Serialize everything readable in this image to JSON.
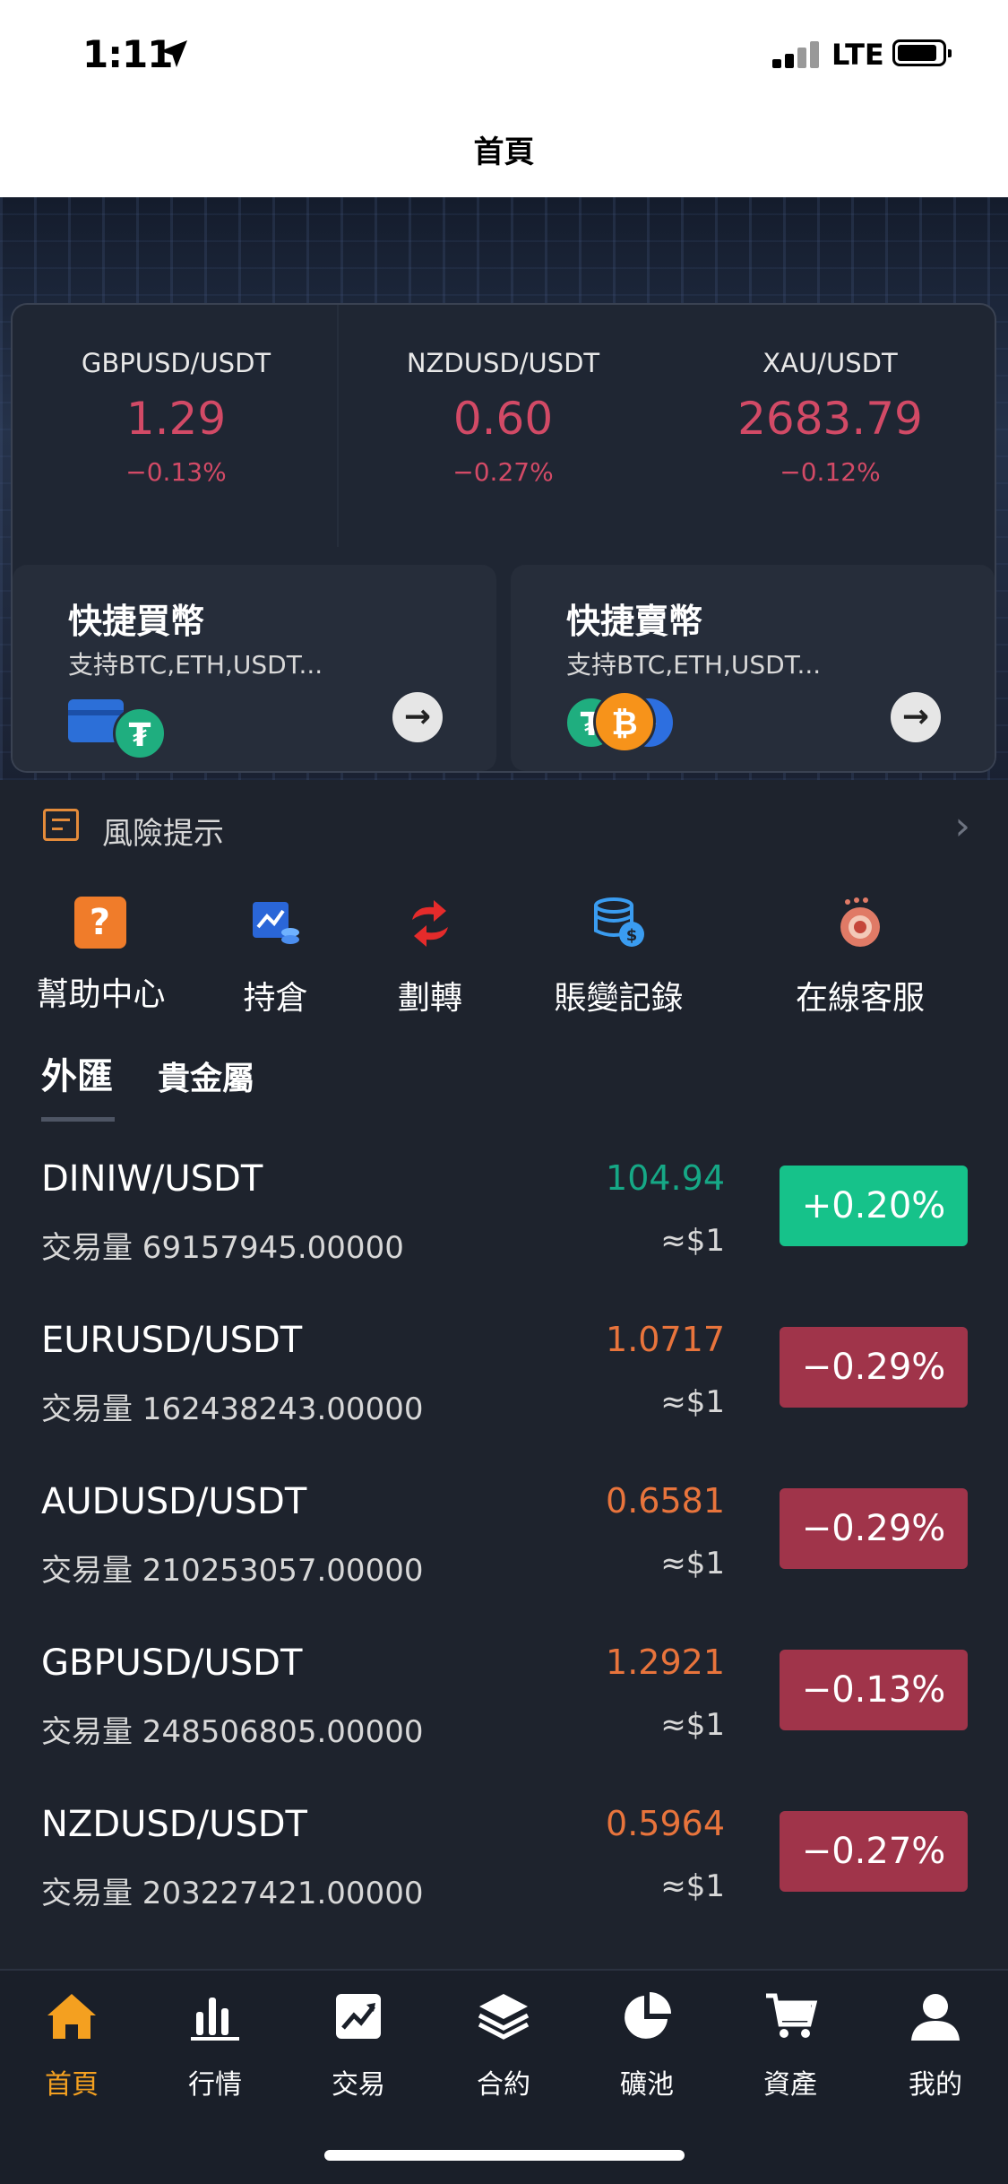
{
  "status_bar": {
    "time": "1:11",
    "network": "LTE"
  },
  "header": {
    "title": "首頁"
  },
  "tickers": [
    {
      "symbol": "GBPUSD/USDT",
      "price": "1.29",
      "change": "−0.13%"
    },
    {
      "symbol": "NZDUSD/USDT",
      "price": "0.60",
      "change": "−0.27%"
    },
    {
      "symbol": "XAU/USDT",
      "price": "2683.79",
      "change": "−0.12%"
    }
  ],
  "quick_buy": {
    "title": "快捷買幣",
    "subtitle": "支持BTC,ETH,USDT..."
  },
  "quick_sell": {
    "title": "快捷賣幣",
    "subtitle": "支持BTC,ETH,USDT..."
  },
  "risk": {
    "label": "風險提示"
  },
  "menu": [
    {
      "label": "幫助中心",
      "icon": "help-icon"
    },
    {
      "label": "持倉",
      "icon": "position-icon"
    },
    {
      "label": "劃轉",
      "icon": "transfer-icon"
    },
    {
      "label": "賬變記錄",
      "icon": "records-icon"
    },
    {
      "label": "在線客服",
      "icon": "support-icon"
    }
  ],
  "market_tabs": [
    {
      "label": "外匯",
      "active": true
    },
    {
      "label": "貴金屬",
      "active": false
    }
  ],
  "markets": [
    {
      "pair": "DINIW/USDT",
      "volume": "交易量 69157945.00000",
      "price": "104.94",
      "approx": "≈$1",
      "change": "+0.20%",
      "direction": "up"
    },
    {
      "pair": "EURUSD/USDT",
      "volume": "交易量 162438243.00000",
      "price": "1.0717",
      "approx": "≈$1",
      "change": "−0.29%",
      "direction": "down"
    },
    {
      "pair": "AUDUSD/USDT",
      "volume": "交易量 210253057.00000",
      "price": "0.6581",
      "approx": "≈$1",
      "change": "−0.29%",
      "direction": "down"
    },
    {
      "pair": "GBPUSD/USDT",
      "volume": "交易量 248506805.00000",
      "price": "1.2921",
      "approx": "≈$1",
      "change": "−0.13%",
      "direction": "down"
    },
    {
      "pair": "NZDUSD/USDT",
      "volume": "交易量 203227421.00000",
      "price": "0.5964",
      "approx": "≈$1",
      "change": "−0.27%",
      "direction": "down"
    }
  ],
  "tabbar": [
    {
      "label": "首頁",
      "icon": "home-icon",
      "active": true
    },
    {
      "label": "行情",
      "icon": "bar-chart-icon",
      "active": false
    },
    {
      "label": "交易",
      "icon": "trade-icon",
      "active": false
    },
    {
      "label": "合約",
      "icon": "layers-icon",
      "active": false
    },
    {
      "label": "礦池",
      "icon": "pie-chart-icon",
      "active": false
    },
    {
      "label": "資產",
      "icon": "cart-icon",
      "active": false
    },
    {
      "label": "我的",
      "icon": "user-icon",
      "active": false
    }
  ],
  "colors": {
    "up": "#16c28a",
    "down": "#d24a66",
    "badge_up": "#16c28a",
    "badge_down": "#a0344a",
    "price_down": "#e8743c",
    "accent": "#f4a020"
  }
}
